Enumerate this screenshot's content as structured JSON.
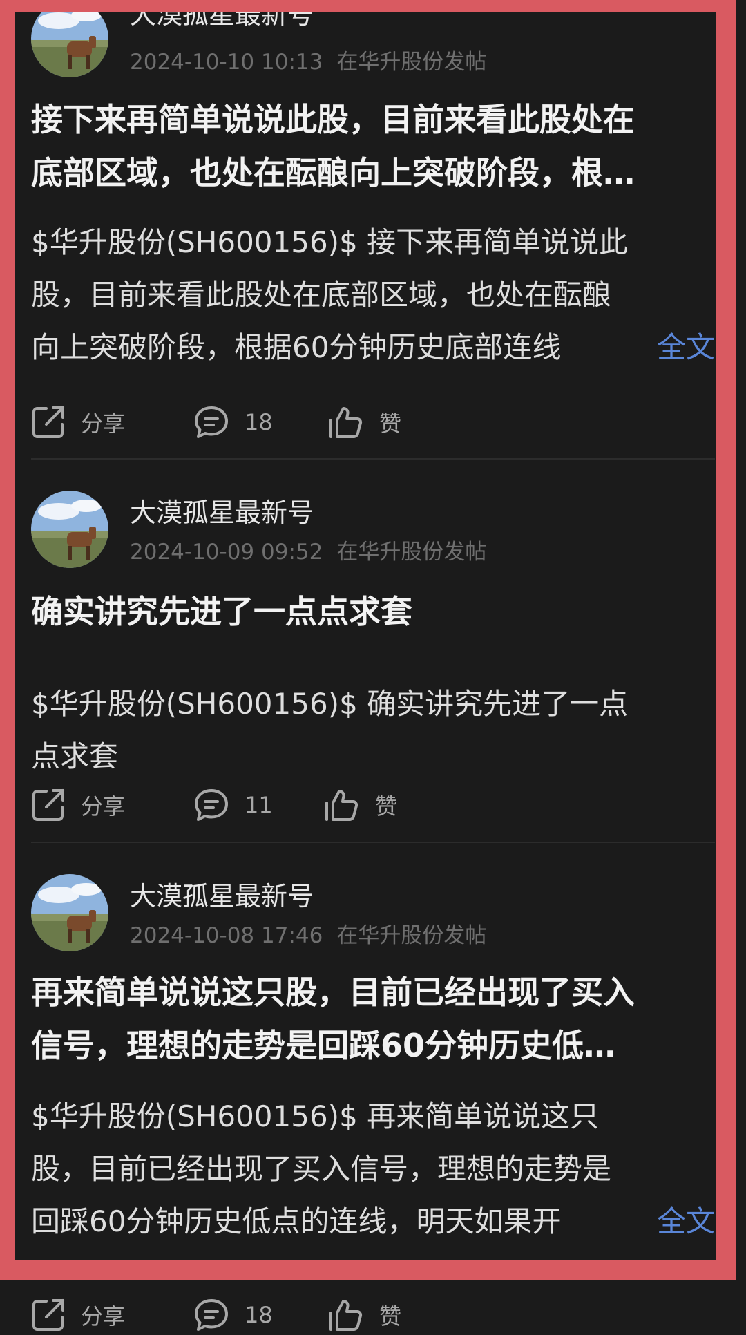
{
  "posts": [
    {
      "author": "大漠孤星最新号",
      "timestamp": "2024-10-10 10:13",
      "location": "在华升股份发帖",
      "title_lines": [
        "接下来再简单说说此股，目前来看此股处在",
        "底部区域，也处在酝酿向上突破阶段，根…"
      ],
      "body_lines": [
        "$华升股份(SH600156)$ 接下来再简单说说此",
        "股，目前来看此股处在底部区域，也处在酝酿",
        "向上突破阶段，根据60分钟历史底部连线"
      ],
      "more_label": "全文",
      "share_label": "分享",
      "comment_count": "18",
      "like_label": "赞"
    },
    {
      "author": "大漠孤星最新号",
      "timestamp": "2024-10-09 09:52",
      "location": "在华升股份发帖",
      "title_lines": [
        "确实讲究先进了一点点求套"
      ],
      "body_lines": [
        "$华升股份(SH600156)$ 确实讲究先进了一点",
        "点求套"
      ],
      "share_label": "分享",
      "comment_count": "11",
      "like_label": "赞"
    },
    {
      "author": "大漠孤星最新号",
      "timestamp": "2024-10-08 17:46",
      "location": "在华升股份发帖",
      "title_lines": [
        "再来简单说说这只股，目前已经出现了买入",
        "信号，理想的走势是回踩60分钟历史低…"
      ],
      "body_lines": [
        "$华升股份(SH600156)$ 再来简单说说这只",
        "股，目前已经出现了买入信号，理想的走势是",
        "回踩60分钟历史低点的连线，明天如果开"
      ],
      "more_label": "全文",
      "share_label": "分享",
      "comment_count": "18",
      "like_label": "赞"
    }
  ],
  "colors": {
    "background": "#1b1b1b",
    "highlight_frame": "#d95a61",
    "link": "#5a86d8",
    "meta_text": "#6f6f6f"
  },
  "icons": {
    "share": "share-icon",
    "comment": "comment-icon",
    "like": "thumbs-up-icon"
  }
}
